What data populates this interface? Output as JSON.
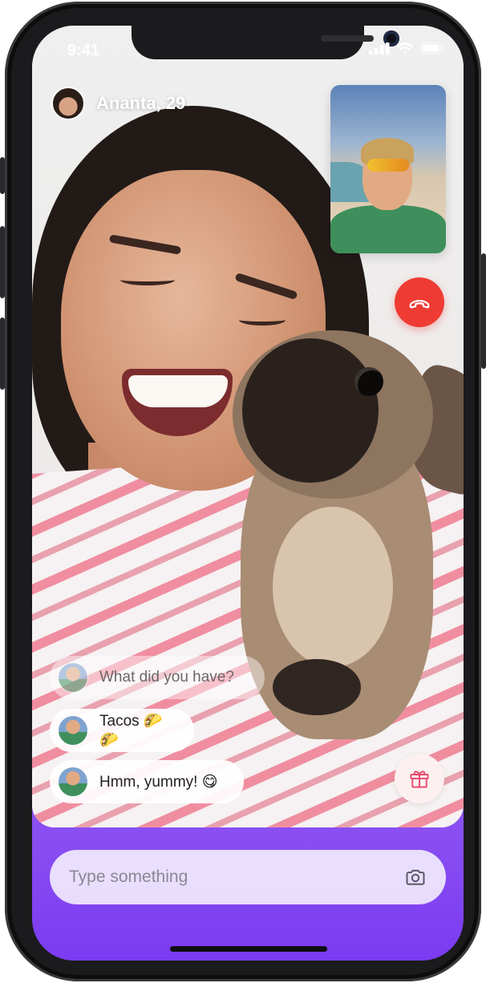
{
  "status_bar": {
    "time": "9:41"
  },
  "header": {
    "name": "Ananta, 29"
  },
  "messages": [
    {
      "text": "What did you have?",
      "faded": true
    },
    {
      "text": "Tacos 🌮🌮",
      "faded": false
    },
    {
      "text": "Hmm, yummy! 😋",
      "faded": false
    }
  ],
  "composer": {
    "placeholder": "Type something"
  },
  "icons": {
    "end_call": "phone-hangup-icon",
    "gift": "gift-icon",
    "camera": "camera-icon"
  },
  "colors": {
    "end_call": "#ee3b34",
    "gift_icon": "#e84f73",
    "gradient_top": "#c9b6f6",
    "gradient_bottom": "#7b3bf1"
  }
}
